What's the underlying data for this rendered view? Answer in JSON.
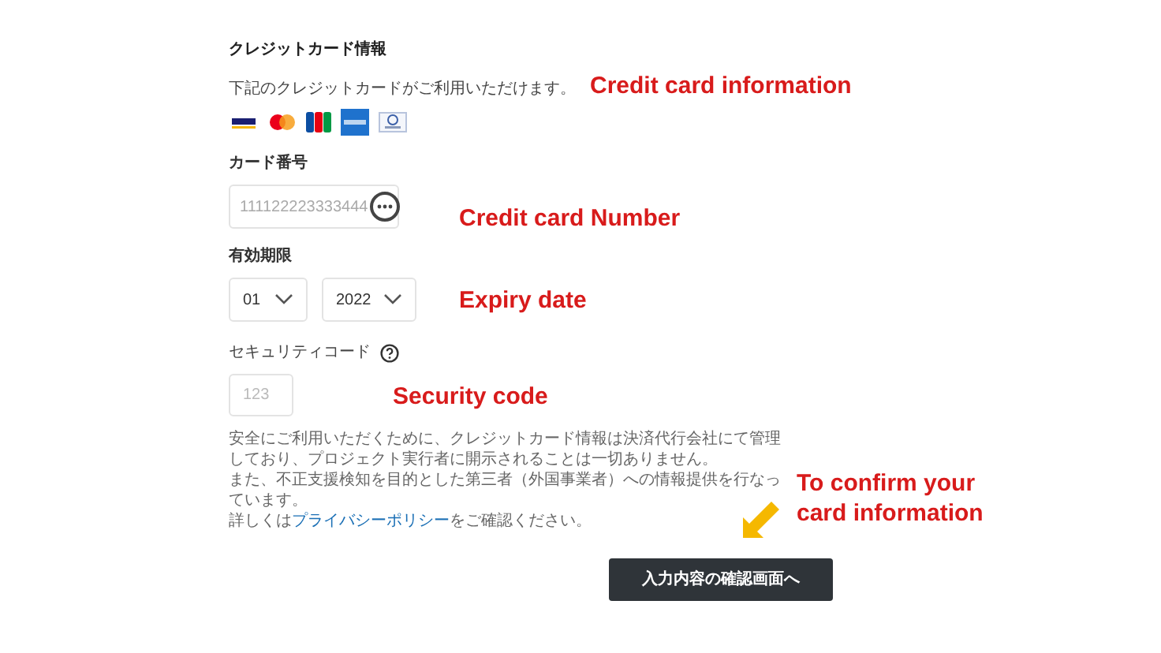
{
  "section_title": "クレジットカード情報",
  "accepted_note": "下記のクレジットカードがご利用いただけます。",
  "card_number": {
    "label": "カード番号",
    "placeholder": "111122223333444"
  },
  "expiry": {
    "label": "有効期限",
    "month": "01",
    "year": "2022"
  },
  "security_code": {
    "label": "セキュリティコード",
    "placeholder": "123"
  },
  "notice": {
    "lines": [
      "安全にご利用いただくために、クレジットカード情報は決済代行会社にて管理しており、プロジェクト実行者に開示されることは一切ありません。",
      "また、不正支援検知を目的とした第三者（外国事業者）への情報提供を行なっています。"
    ],
    "policy_before": "詳しくは",
    "policy_link": "プライバシーポリシー",
    "policy_after": "をご確認ください。"
  },
  "submit_button": "入力内容の確認画面へ",
  "annotations": [
    "Credit card information",
    "Credit card Number",
    "Expiry date",
    "Security code",
    "To confirm your card information"
  ]
}
